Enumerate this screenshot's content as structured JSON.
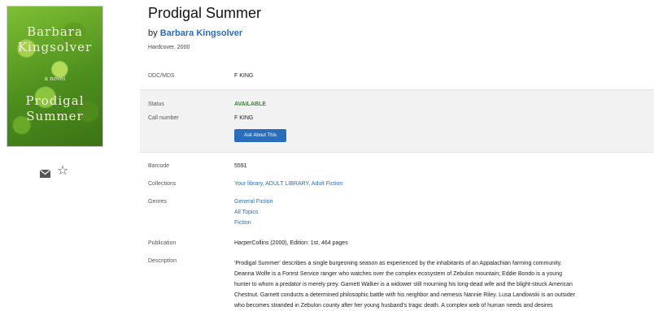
{
  "book": {
    "cover_author": "Barbara Kingsolver",
    "cover_small": "a novel",
    "cover_title": "Prodigal Summer",
    "title": "Prodigal Summer",
    "by_prefix": "by",
    "author": "Barbara Kingsolver",
    "format": "Hardcover, 2000"
  },
  "icons": {
    "mail": "envelope-icon",
    "favorite": "star-outline-icon"
  },
  "details": {
    "ddc_label": "DDC/MDS",
    "ddc_value": "F KING",
    "status_label": "Status",
    "status_value": "AVAILABLE",
    "call_label": "Call number",
    "call_value": "F KING",
    "ask_button": "Ask About This",
    "barcode_label": "Barcode",
    "barcode_value": "5591",
    "collections_label": "Collections",
    "collections_value": "Your library, ADULT LIBRARY, Adult Fiction",
    "genres_label": "Genres",
    "genres": [
      "General Fiction",
      "All Topics",
      "Fiction"
    ],
    "publication_label": "Publication",
    "publication_value": "HarperCollins (2000), Edition: 1st, 464 pages",
    "description_label": "Description",
    "description_lines": [
      "'Prodigal Summer' describes a single burgeoning season as experienced by the inhabitants of an Appalachian farming community.",
      "Deanna Wolfe is a Forest Service ranger who watches over the complex ecosystem of Zebulon mountain; Eddie Bondo is a young",
      "hunter to whom a predator is merely prey. Garnett Walker is a widower still mourning his long-dead wife and the blight-struck American",
      "Chestnut. Garnett conducts a determined philosophic battle with his neighbor and nemesis Nannie Riley. Lusa Landowski is an outsider",
      "who becomes stranded in Zebulon county after her young husband's tragic death. A complex web of human needs and desires"
    ]
  },
  "colors": {
    "link": "#2a6ebb",
    "available": "#2e8b2e",
    "button": "#2a6ebb",
    "panel": "#f2f2f2"
  }
}
